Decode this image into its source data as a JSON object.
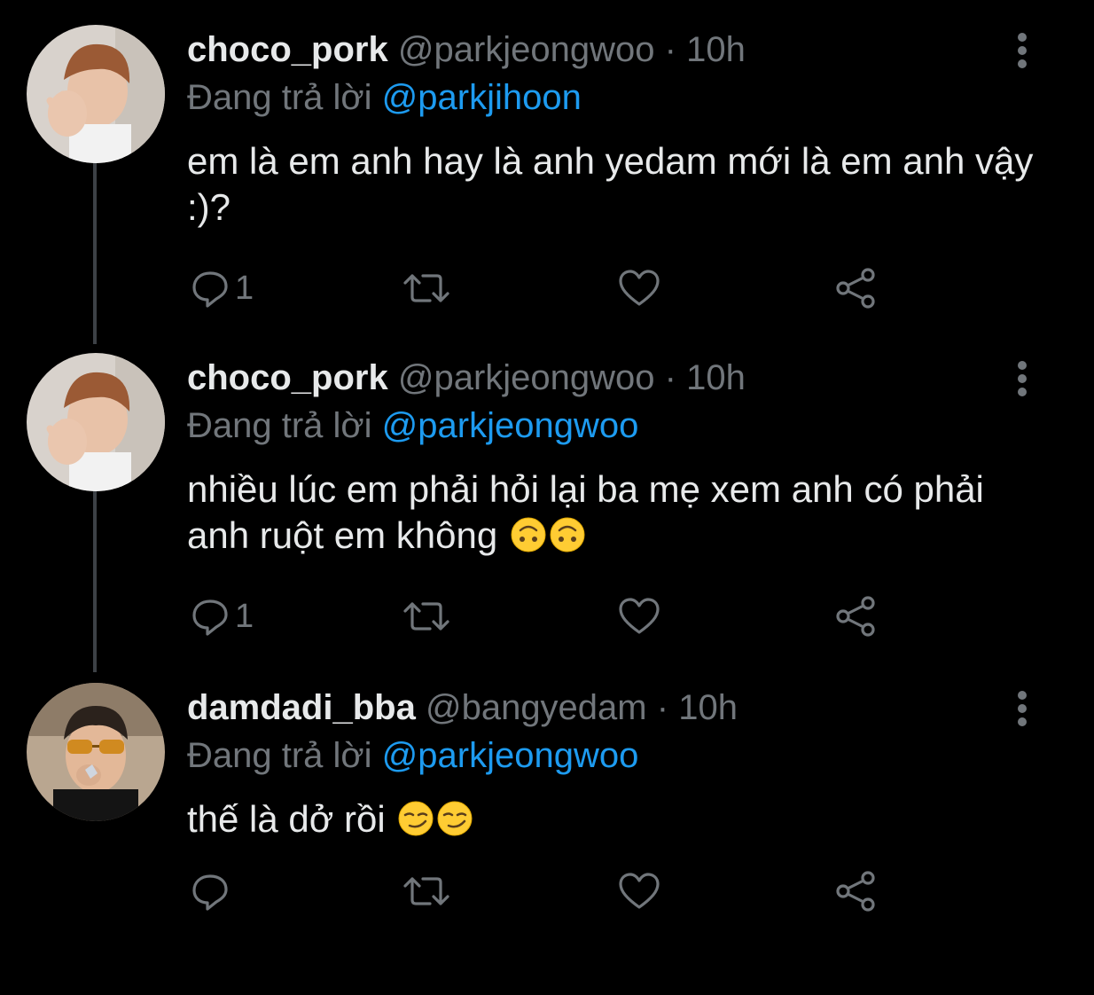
{
  "tweets": [
    {
      "name": "choco_pork",
      "handle": "@parkjeongwoo",
      "separator": "·",
      "time": "10h",
      "reply_prefix": "Đang trả lời",
      "reply_to": "@parkjihoon",
      "text": "em là em anh hay là anh yedam mới là em anh vậy :)?",
      "emojis": [],
      "reply_count": "1",
      "avatar_icon": "person-photo-avatar"
    },
    {
      "name": "choco_pork",
      "handle": "@parkjeongwoo",
      "separator": "·",
      "time": "10h",
      "reply_prefix": "Đang trả lời",
      "reply_to": "@parkjeongwoo",
      "text": "nhiều lúc em phải hỏi lại ba mẹ xem anh có phải anh ruột em không",
      "emojis": [
        "upside-down-face-emoji",
        "upside-down-face-emoji"
      ],
      "reply_count": "1",
      "avatar_icon": "person-photo-avatar"
    },
    {
      "name": "damdadi_bba",
      "handle": "@bangyedam",
      "separator": "·",
      "time": "10h",
      "reply_prefix": "Đang trả lời",
      "reply_to": "@parkjeongwoo",
      "text": "thế là dở rồi",
      "emojis": [
        "smirking-face-emoji",
        "smirking-face-emoji"
      ],
      "reply_count": "",
      "avatar_icon": "person-photo-avatar"
    }
  ],
  "icons": {
    "reply": "reply-icon",
    "retweet": "retweet-icon",
    "like": "heart-icon",
    "share": "share-icon",
    "more": "more-vertical-icon"
  },
  "colors": {
    "background": "#000000",
    "text": "#e7e9ea",
    "muted": "#71767b",
    "link": "#1d9bf0",
    "thread_line": "#3d4146"
  }
}
